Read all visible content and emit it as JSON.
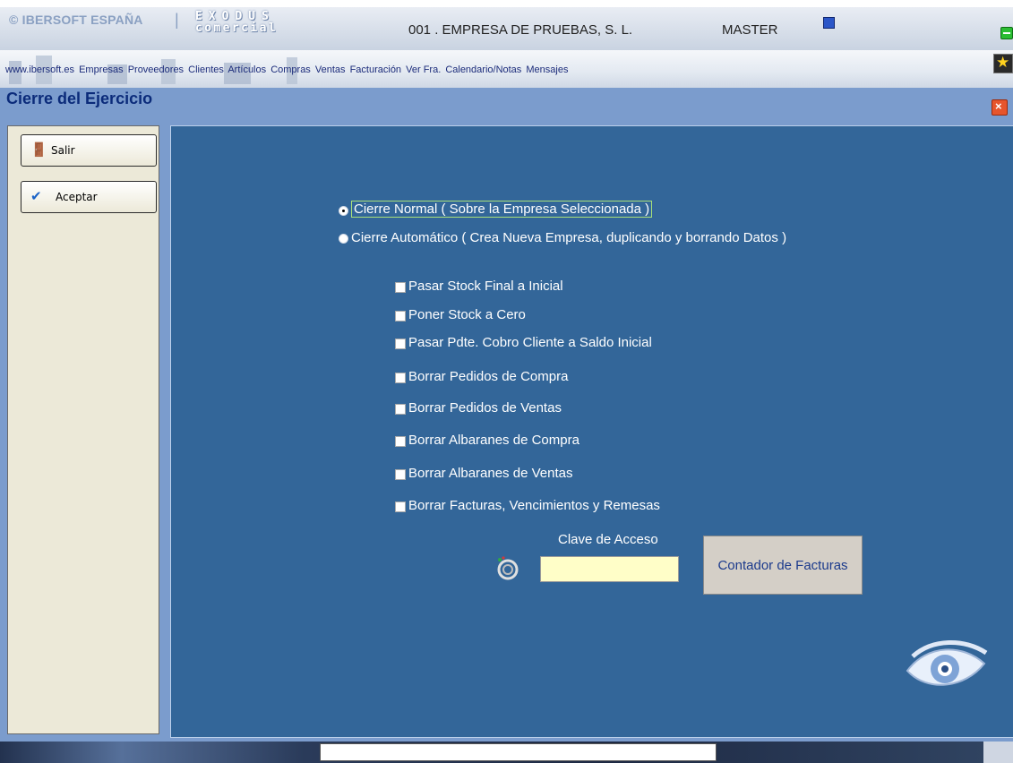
{
  "header": {
    "brand": "© IBERSOFT ESPAÑA",
    "separator": "|",
    "logo_line1": "EXODUS",
    "logo_line2": "comercial",
    "company": "001 . EMPRESA DE PRUEBAS, S. L.",
    "user": "MASTER"
  },
  "menu": {
    "items": [
      "www.ibersoft.es",
      "Empresas",
      "Proveedores",
      "Clientes",
      "Artículos",
      "Compras",
      "Ventas",
      "Facturación",
      "Ver Fra.",
      "Calendario/Notas",
      "Mensajes"
    ]
  },
  "window": {
    "title": "Cierre del Ejercicio",
    "close_icon": "×"
  },
  "sidebar": {
    "exit_label": "Salir",
    "accept_label": "Aceptar"
  },
  "options": {
    "radios": [
      {
        "label": "Cierre Normal ( Sobre la Empresa Seleccionada )",
        "selected": true
      },
      {
        "label": "Cierre Automático ( Crea Nueva Empresa, duplicando y borrando Datos )",
        "selected": false
      }
    ],
    "checks": [
      {
        "label": "Pasar Stock Final a Inicial",
        "checked": false
      },
      {
        "label": "Poner Stock a Cero",
        "checked": false
      },
      {
        "label": "Pasar Pdte. Cobro Cliente a Saldo Inicial",
        "checked": false
      },
      {
        "label": "Borrar Pedidos de Compra",
        "checked": false
      },
      {
        "label": "Borrar Pedidos de Ventas",
        "checked": false
      },
      {
        "label": "Borrar Albaranes de Compra",
        "checked": false
      },
      {
        "label": "Borrar Albaranes de Ventas",
        "checked": false
      },
      {
        "label": "Borrar Facturas, Vencimientos y Remesas",
        "checked": false
      }
    ]
  },
  "access": {
    "label": "Clave de Acceso",
    "value": "",
    "counter_button": "Contador de Facturas"
  },
  "colors": {
    "panel": "#336699",
    "window": "#7b9ccd",
    "title": "#0b2b7a",
    "input_bg": "#fffec8"
  }
}
